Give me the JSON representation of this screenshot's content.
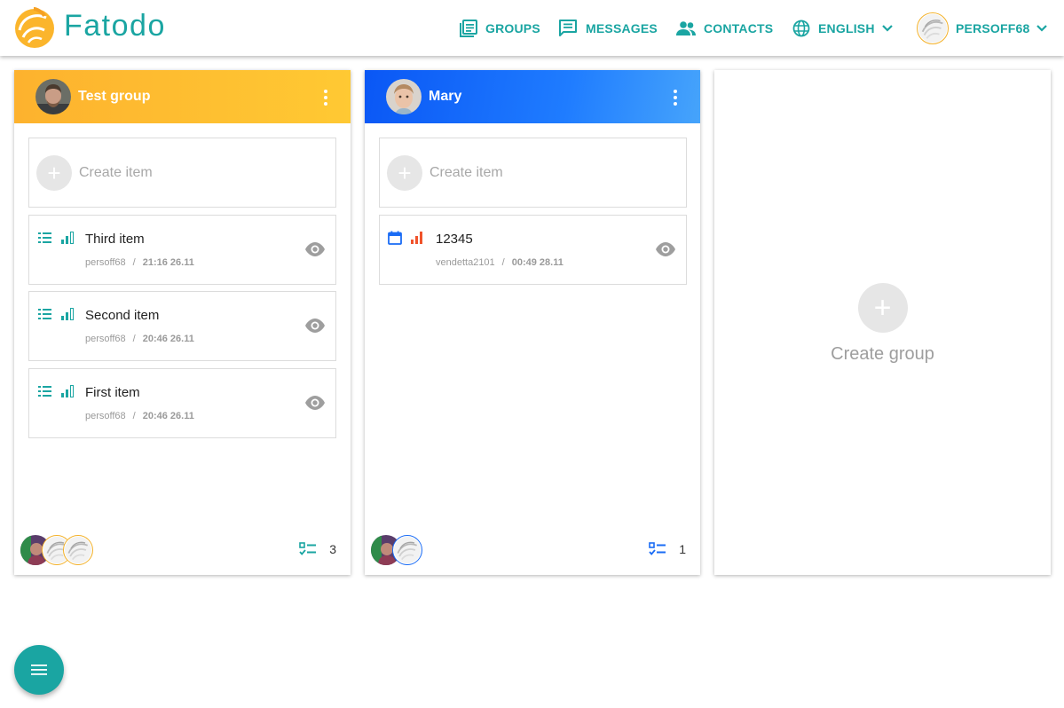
{
  "brand": {
    "name": "Fatodo"
  },
  "nav": {
    "groups": "GROUPS",
    "messages": "MESSAGES",
    "contacts": "CONTACTS",
    "language": "ENGLISH",
    "user": "PERSOFF68"
  },
  "colors": {
    "accent": "#1aa5a2",
    "orange": "#fdb22e",
    "blue": "#0a57f5"
  },
  "groups": [
    {
      "title": "Test group",
      "create_label": "Create item",
      "items": [
        {
          "title": "Third item",
          "author": "persoff68",
          "sep": "/",
          "time": "21:16 26.11",
          "icon": "list-icon",
          "priority": "signal-icon"
        },
        {
          "title": "Second item",
          "author": "persoff68",
          "sep": "/",
          "time": "20:46 26.11",
          "icon": "list-icon",
          "priority": "signal-icon"
        },
        {
          "title": "First item",
          "author": "persoff68",
          "sep": "/",
          "time": "20:46 26.11",
          "icon": "list-icon",
          "priority": "signal-icon"
        }
      ],
      "count": "3"
    },
    {
      "title": "Mary",
      "create_label": "Create item",
      "items": [
        {
          "title": "12345",
          "author": "vendetta2101",
          "sep": "/",
          "time": "00:49 28.11",
          "icon": "calendar-icon",
          "priority": "signal-icon"
        }
      ],
      "count": "1"
    }
  ],
  "create_group": {
    "label": "Create group"
  }
}
